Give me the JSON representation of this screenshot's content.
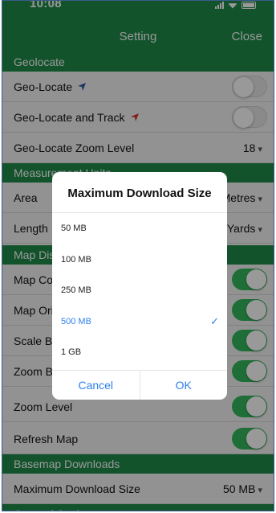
{
  "status": {
    "time": "10:08"
  },
  "nav": {
    "title": "Setting",
    "close": "Close"
  },
  "sections": {
    "geolocate": "Geolocate",
    "measure": "Measurement Units",
    "map_display": "Map Display",
    "basemap": "Basemap Downloads",
    "general": "General Settings"
  },
  "rows": {
    "geo_locate": {
      "label": "Geo-Locate",
      "on": false,
      "arrow_color": "#2c5aa0"
    },
    "geo_track": {
      "label": "Geo-Locate and Track",
      "on": false,
      "arrow_color": "#d9342b"
    },
    "zoom_level_geo": {
      "label": "Geo-Locate Zoom Level",
      "value": "18"
    },
    "area": {
      "label": "Area",
      "value": "Metres"
    },
    "length": {
      "label": "Length",
      "value": "Yards"
    },
    "map_compass": {
      "label": "Map Compass",
      "on": true
    },
    "map_orientation": {
      "label": "Map Orientation",
      "on": true
    },
    "scale_bar": {
      "label": "Scale Bar",
      "on": true
    },
    "zoom_buttons": {
      "label": "Zoom Buttons",
      "on": true
    },
    "zoom_level": {
      "label": "Zoom Level",
      "on": true
    },
    "refresh_map": {
      "label": "Refresh Map",
      "on": true
    },
    "max_download": {
      "label": "Maximum Download Size",
      "value": "50 MB"
    }
  },
  "dialog": {
    "title": "Maximum Download Size",
    "options": [
      "50 MB",
      "100 MB",
      "250 MB",
      "500 MB",
      "1 GB"
    ],
    "selected_index": 3,
    "cancel": "Cancel",
    "ok": "OK"
  },
  "colors": {
    "green": "#1f8a4a",
    "toggle_on": "#35b85e",
    "accent": "#2f80ed"
  }
}
